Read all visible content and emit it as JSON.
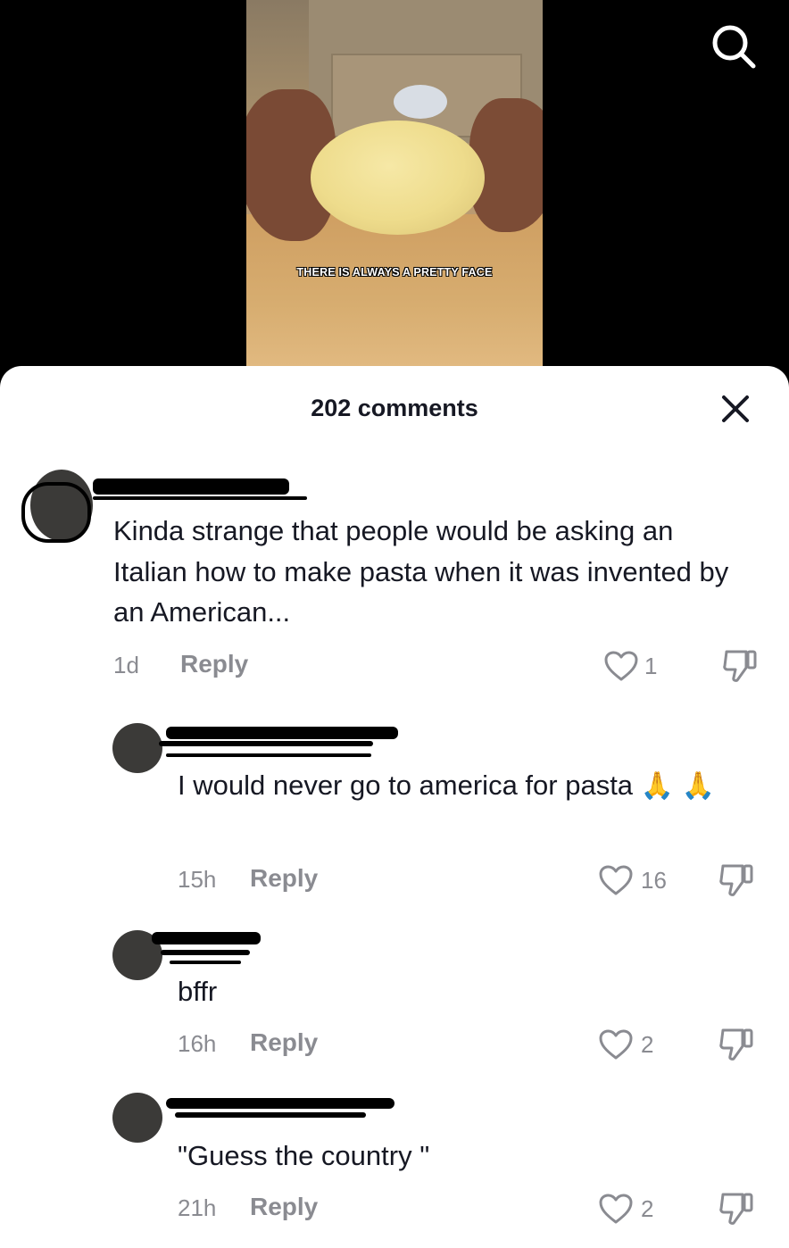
{
  "video": {
    "caption": "THERE IS ALWAYS A PRETTY FACE"
  },
  "sheet": {
    "title": "202 comments"
  },
  "comments": [
    {
      "text": "Kinda strange that people would be asking an Italian how to make pasta when it was invented by an American...",
      "time": "1d",
      "reply": "Reply",
      "likes": "1"
    },
    {
      "text": "I would never go to america for pasta",
      "emoji": "🙏",
      "time": "15h",
      "reply": "Reply",
      "likes": "16"
    },
    {
      "text": "bffr",
      "time": "16h",
      "reply": "Reply",
      "likes": "2"
    },
    {
      "text": "\"Guess the country \"",
      "time": "21h",
      "reply": "Reply",
      "likes": "2"
    }
  ],
  "colors": {
    "text_primary": "#161823",
    "text_secondary": "#8a8b91",
    "sheet_bg": "#ffffff",
    "backdrop": "#000000"
  },
  "icons": [
    "search-icon",
    "close-icon",
    "heart-icon",
    "dislike-icon"
  ]
}
